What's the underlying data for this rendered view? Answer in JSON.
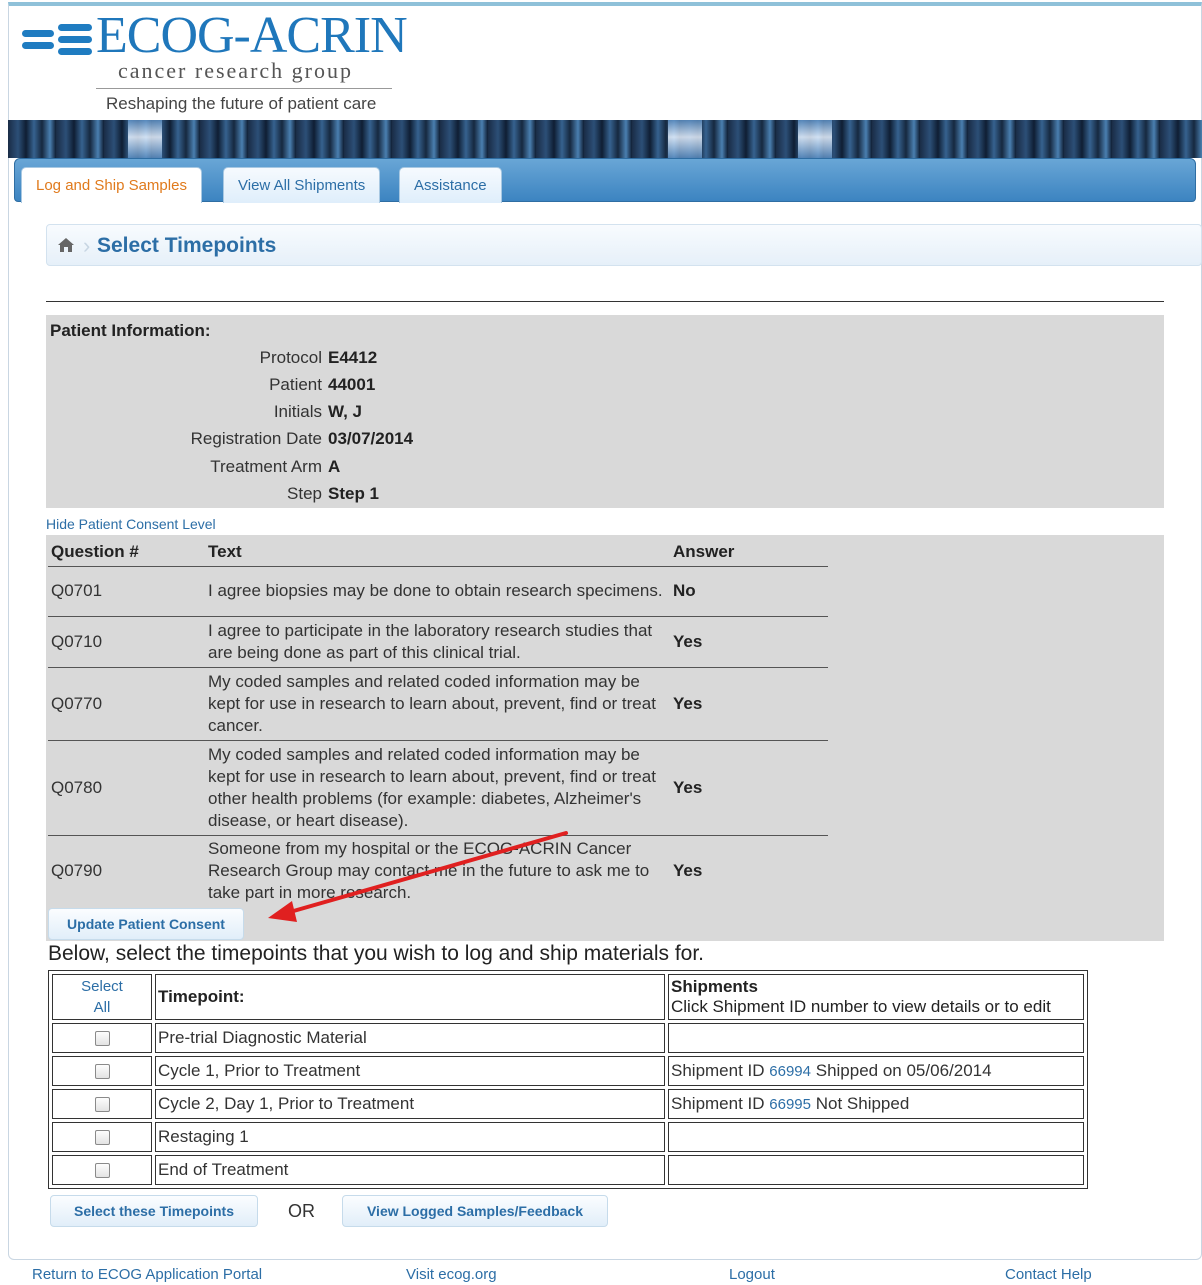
{
  "logo": {
    "wordmark": "ECOG-ACRIN",
    "tagline": "cancer research group",
    "slogan": "Reshaping the future of patient care"
  },
  "tabs": [
    {
      "label": "Log and Ship Samples",
      "active": true
    },
    {
      "label": "View All Shipments",
      "active": false
    },
    {
      "label": "Assistance",
      "active": false
    }
  ],
  "breadcrumb": {
    "title": "Select Timepoints",
    "icon": "home-icon"
  },
  "patient": {
    "heading": "Patient Information:",
    "rows": [
      {
        "label": "Protocol",
        "value": "E4412"
      },
      {
        "label": "Patient",
        "value": "44001"
      },
      {
        "label": "Initials",
        "value": "W, J"
      },
      {
        "label": "Registration Date",
        "value": "03/07/2014"
      },
      {
        "label": "Treatment Arm",
        "value": "A"
      },
      {
        "label": "Step",
        "value": "Step 1"
      }
    ]
  },
  "consent": {
    "toggle_link": "Hide Patient Consent Level",
    "headers": {
      "question": "Question #",
      "text": "Text",
      "answer": "Answer"
    },
    "rows": [
      {
        "q": "Q0701",
        "text": "I agree biopsies may be done to obtain research specimens.",
        "answer": "No"
      },
      {
        "q": "Q0710",
        "text": "I agree to participate in the laboratory research studies that are being done as part of this clinical trial.",
        "answer": "Yes"
      },
      {
        "q": "Q0770",
        "text": "My coded samples and related coded information may be kept for use in research to learn about, prevent, find or treat cancer.",
        "answer": "Yes"
      },
      {
        "q": "Q0780",
        "text": "My coded samples and related coded information may be kept for use in research to learn about, prevent, find or treat other health problems (for example: diabetes, Alzheimer's disease, or heart disease).",
        "answer": "Yes"
      },
      {
        "q": "Q0790",
        "text": "Someone from my hospital or the ECOG-ACRIN Cancer Research Group may contact me in the future to ask me to take part in more research.",
        "answer": "Yes"
      }
    ],
    "update_button": "Update Patient Consent"
  },
  "timepoints": {
    "instruction": "Below, select the timepoints that you wish to log and ship materials for.",
    "select_all": {
      "line1": "Select",
      "line2": "All"
    },
    "header_timepoint": "Timepoint:",
    "header_shipments": "Shipments",
    "header_shipments_sub": "Click Shipment ID number to view details or to edit",
    "rows": [
      {
        "name": "Pre-trial Diagnostic Material",
        "ship_prefix": "",
        "ship_id": "",
        "ship_status": ""
      },
      {
        "name": "Cycle 1, Prior to Treatment",
        "ship_prefix": "Shipment ID",
        "ship_id": "66994",
        "ship_status": "Shipped on 05/06/2014"
      },
      {
        "name": "Cycle 2, Day 1, Prior to Treatment",
        "ship_prefix": "Shipment ID",
        "ship_id": "66995",
        "ship_status": "Not Shipped"
      },
      {
        "name": "Restaging 1",
        "ship_prefix": "",
        "ship_id": "",
        "ship_status": ""
      },
      {
        "name": "End of Treatment",
        "ship_prefix": "",
        "ship_id": "",
        "ship_status": ""
      }
    ],
    "select_button": "Select these Timepoints",
    "or_text": "OR",
    "view_button": "View Logged Samples/Feedback"
  },
  "footer": {
    "portal": "Return to ECOG Application Portal",
    "visit": "Visit ecog.org",
    "logout": "Logout",
    "help": "Contact Help"
  },
  "colors": {
    "link": "#2c6ea6",
    "active_tab": "#e07a1c",
    "annotation_arrow": "#e02020",
    "panel_gray": "#d9d9d9"
  }
}
